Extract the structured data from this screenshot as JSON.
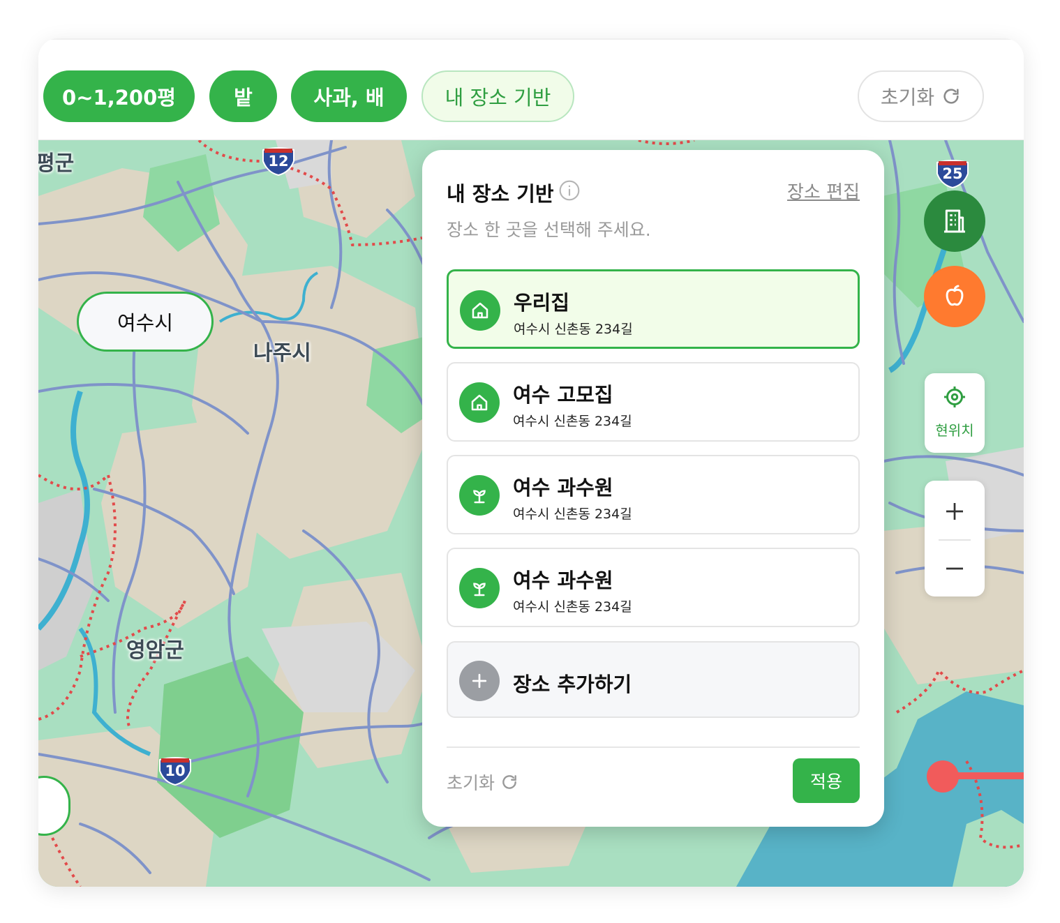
{
  "filters": {
    "chips": [
      "0~1,200평",
      "밭",
      "사과, 배",
      "내 장소 기반"
    ],
    "reset_label": "초기화"
  },
  "map": {
    "labels": {
      "top_left": "평군",
      "naju": "나주시",
      "yeongam": "영암군"
    },
    "shields": [
      "12",
      "25",
      "10"
    ],
    "marker_label": "여수시"
  },
  "panel": {
    "title": "내 장소 기반",
    "edit_label": "장소 편집",
    "subtitle": "장소 한 곳을 선택해 주세요.",
    "places": [
      {
        "name": "우리집",
        "address": "여수시 신촌동 234길",
        "icon": "home-icon",
        "selected": true
      },
      {
        "name": "여수 고모집",
        "address": "여수시 신촌동 234길",
        "icon": "home-icon",
        "selected": false
      },
      {
        "name": "여수 과수원",
        "address": "여수시 신촌동 234길",
        "icon": "sprout-icon",
        "selected": false
      },
      {
        "name": "여수 과수원",
        "address": "여수시 신촌동 234길",
        "icon": "sprout-icon",
        "selected": false
      }
    ],
    "add_label": "장소 추가하기",
    "reset_label": "초기화",
    "apply_label": "적용"
  },
  "controls": {
    "locate_label": "현위치",
    "building_icon": "building-icon",
    "apple_icon": "apple-icon"
  },
  "colors": {
    "primary": "#34b34a",
    "orange": "#ff7a2f",
    "dark_green": "#2b8a3e",
    "slider": "#f15b5b"
  }
}
